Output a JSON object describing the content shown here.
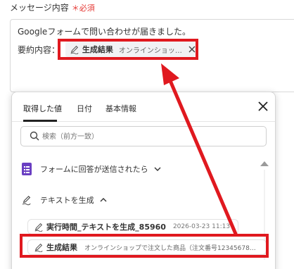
{
  "field": {
    "label": "メッセージ内容",
    "required": "＊必須"
  },
  "message": {
    "line1": "Googleフォームで問い合わせが届きました。",
    "line2_label": "要約内容：",
    "chip": {
      "name": "生成結果",
      "value": "オンラインショップで…"
    }
  },
  "panel": {
    "tabs": [
      {
        "label": "取得した値",
        "active": true
      },
      {
        "label": "日付",
        "active": false
      },
      {
        "label": "基本情報",
        "active": false
      }
    ],
    "search": {
      "placeholder": "検索（前方一致）"
    },
    "sections": [
      {
        "label": "フォームに回答が送信されたら"
      },
      {
        "label": "テキストを生成"
      }
    ],
    "items": [
      {
        "name": "実行時間_テキストを生成_85960",
        "meta": "2026-03-23 11:13"
      },
      {
        "name": "生成結果",
        "value": "オンラインショップで注文した商品（注文番号12345678…"
      }
    ]
  },
  "colors": {
    "highlight": "#e0191f",
    "required": "#e53935",
    "form_icon": "#6a3fc2"
  }
}
